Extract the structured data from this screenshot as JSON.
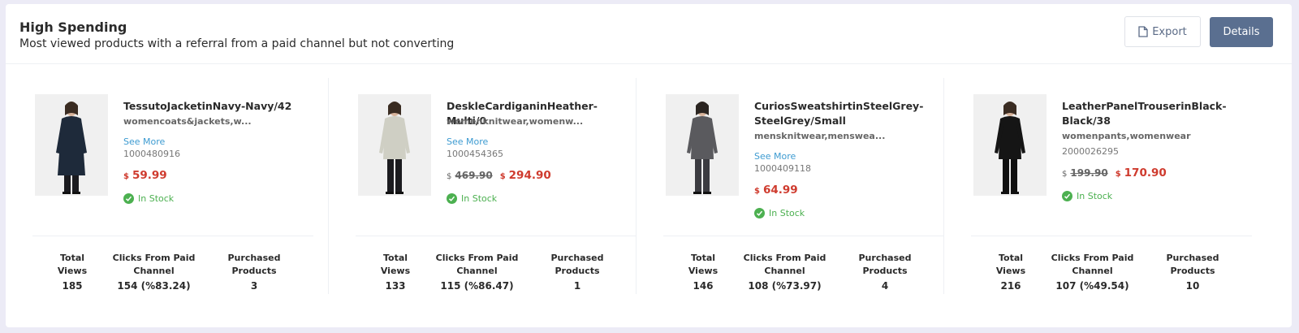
{
  "header": {
    "title": "High Spending",
    "subtitle": "Most viewed products with a referral from a paid channel but not converting",
    "export_label": "Export",
    "details_label": "Details"
  },
  "stat_labels": {
    "views_1": "Total",
    "views_2": "Views",
    "clicks_1": "Clicks From Paid",
    "clicks_2": "Channel",
    "purchased_1": "Purchased",
    "purchased_2": "Products"
  },
  "products": [
    {
      "name": "TessutoJacketinNavy-Navy/42",
      "category": "womencoats&jackets,w...",
      "see_more": "See More",
      "sku": "1000480916",
      "currency": "$",
      "old_price": "",
      "price": "59.99",
      "stock": "In Stock",
      "total_views": "185",
      "clicks": "154 (%83.24)",
      "purchased": "3",
      "garment_color": "#1e2a3a"
    },
    {
      "name": "DeskleCardiganinHeather-Multi/0",
      "category": "womenknitwear,womenw...",
      "see_more": "See More",
      "sku": "1000454365",
      "currency": "$",
      "old_price": "469.90",
      "price": "294.90",
      "stock": "In Stock",
      "total_views": "133",
      "clicks": "115 (%86.47)",
      "purchased": "1",
      "garment_color": "#cfcfc4"
    },
    {
      "name": "CuriosSweatshirtinSteelGrey-SteelGrey/Small",
      "category": "mensknitwear,menswea...",
      "see_more": "See More",
      "sku": "1000409118",
      "currency": "$",
      "old_price": "",
      "price": "64.99",
      "stock": "In Stock",
      "total_views": "146",
      "clicks": "108 (%73.97)",
      "purchased": "4",
      "garment_color": "#5a5a5e"
    },
    {
      "name": "LeatherPanelTrouserinBlack-Black/38",
      "category": "womenpants,womenwear",
      "see_more": "",
      "sku": "2000026295",
      "currency": "$",
      "old_price": "199.90",
      "price": "170.90",
      "stock": "In Stock",
      "total_views": "216",
      "clicks": "107 (%49.54)",
      "purchased": "10",
      "garment_color": "#151515"
    }
  ]
}
